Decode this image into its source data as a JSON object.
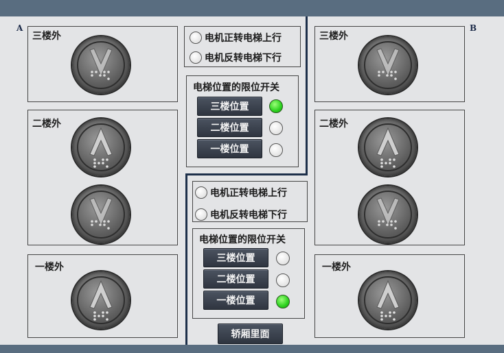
{
  "corners": {
    "left": "A",
    "right": "B"
  },
  "shafts": [
    {
      "id": "A",
      "floors": [
        {
          "label": "三楼外",
          "buttons": [
            "down"
          ]
        },
        {
          "label": "二楼外",
          "buttons": [
            "up",
            "down"
          ]
        },
        {
          "label": "一楼外",
          "buttons": [
            "up"
          ]
        }
      ]
    },
    {
      "id": "B",
      "floors": [
        {
          "label": "三楼外",
          "buttons": [
            "down"
          ]
        },
        {
          "label": "二楼外",
          "buttons": [
            "up",
            "down"
          ]
        },
        {
          "label": "一楼外",
          "buttons": [
            "up"
          ]
        }
      ]
    }
  ],
  "controls": [
    {
      "motor_forward": "电机正转电梯上行",
      "motor_reverse": "电机反转电梯下行",
      "limit_title": "电梯位置的限位开关",
      "positions": [
        {
          "label": "三楼位置",
          "active": true
        },
        {
          "label": "二楼位置",
          "active": false
        },
        {
          "label": "一楼位置",
          "active": false
        }
      ]
    },
    {
      "motor_forward": "电机正转电梯上行",
      "motor_reverse": "电机反转电梯下行",
      "limit_title": "电梯位置的限位开关",
      "positions": [
        {
          "label": "三楼位置",
          "active": false
        },
        {
          "label": "二楼位置",
          "active": false
        },
        {
          "label": "一楼位置",
          "active": true
        }
      ]
    }
  ],
  "car_button": "轿厢里面",
  "colors": {
    "bar": "#596d80",
    "divider": "#1d2f4a",
    "led_on": "#2bd11e"
  }
}
